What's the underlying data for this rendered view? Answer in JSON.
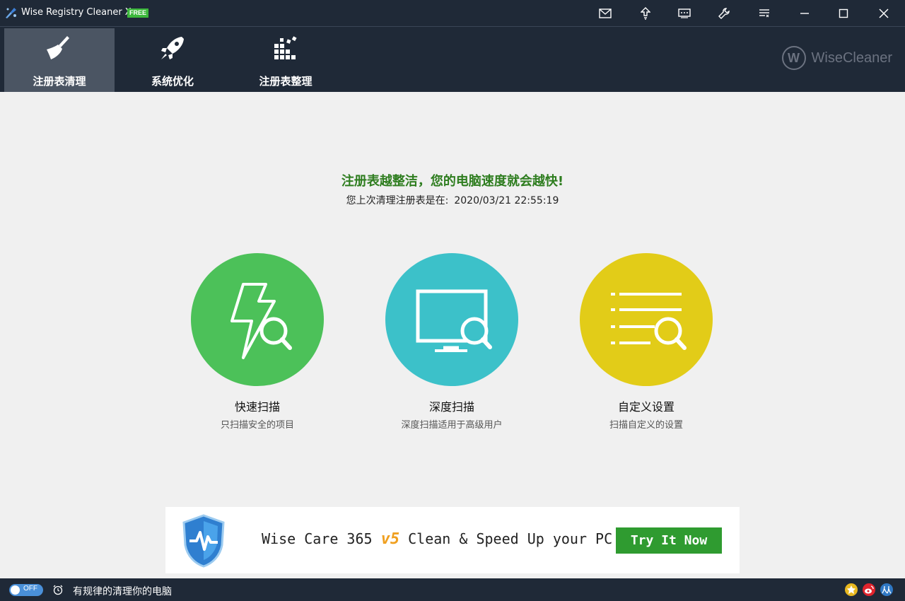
{
  "window": {
    "title": "Wise Registry Cleaner X",
    "badge": "FREE",
    "controls": [
      "mail-icon",
      "upgrade-icon",
      "feedback-icon",
      "settings-icon",
      "menu-icon",
      "minimize-icon",
      "maximize-icon",
      "close-icon"
    ]
  },
  "toolbar": {
    "tabs": [
      {
        "label": "注册表清理",
        "icon": "broom-icon",
        "active": true
      },
      {
        "label": "系统优化",
        "icon": "rocket-icon",
        "active": false
      },
      {
        "label": "注册表整理",
        "icon": "defrag-icon",
        "active": false
      }
    ],
    "brand": "WiseCleaner",
    "brand_mark": "W"
  },
  "main": {
    "headline": "注册表越整洁，您的电脑速度就会越快!",
    "last_clean_label": "您上次清理注册表是在:",
    "last_clean_value": "2020/03/21 22:55:19",
    "scan_options": [
      {
        "title": "快速扫描",
        "subtitle": "只扫描安全的项目",
        "color": "#4cc159",
        "icon": "lightning-search-icon"
      },
      {
        "title": "深度扫描",
        "subtitle": "深度扫描适用于高级用户",
        "color": "#3cc1c9",
        "icon": "monitor-search-icon"
      },
      {
        "title": "自定义设置",
        "subtitle": "扫描自定义的设置",
        "color": "#e2cc18",
        "icon": "list-search-icon"
      }
    ]
  },
  "ad": {
    "text_before": "Wise Care 365 ",
    "version": "v5",
    "text_after": " Clean & Speed Up your PC!",
    "button": "Try It Now"
  },
  "statusbar": {
    "toggle_label": "OFF",
    "schedule_text": "有规律的清理你的电脑",
    "social": [
      {
        "icon": "like-icon",
        "color": "#e8b820"
      },
      {
        "icon": "weibo-icon",
        "color": "#e0242d"
      },
      {
        "icon": "renren-icon",
        "color": "#2f78c4"
      }
    ]
  }
}
